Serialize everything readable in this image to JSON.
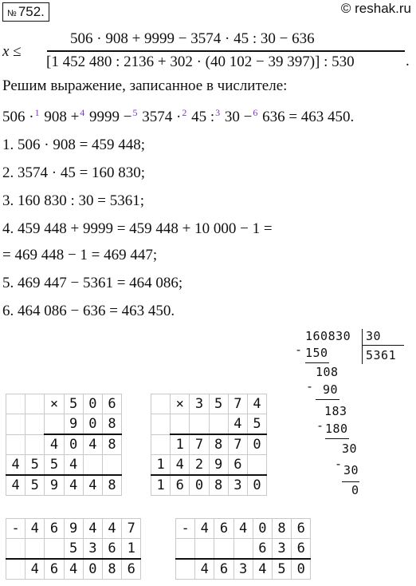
{
  "header": {
    "number_prefix": "№",
    "number": "752.",
    "site": "© reshak.ru"
  },
  "inequality": {
    "lhs": "x ≤",
    "numerator": "506 · 908 + 9999 − 3574 · 45 : 30 − 636",
    "denominator": "[1 452 480 : 2136 + 302 · (40 102 − 39 397)] : 530",
    "period": "."
  },
  "intro": "Решим выражение, записанное в числителе:",
  "expression": {
    "parts": [
      "506 ·",
      "908 +",
      "9999 −",
      "3574 ·",
      "45 :",
      "30 −",
      "636 = 463 450."
    ],
    "marks": [
      "1",
      "4",
      "5",
      "2",
      "3",
      "6"
    ]
  },
  "steps": [
    "1.  506 · 908 = 459 448;",
    "2.  3574 · 45 = 160 830;",
    "3.  160 830 : 30 = 5361;",
    "4.  459 448 + 9999 = 459 448 + 10 000 − 1 =",
    "= 469 448 − 1 = 469 447;",
    "5.  469 447 − 5361 = 464 086;",
    "6.  464 086 − 636 = 463 450."
  ],
  "mult1": {
    "rows": [
      [
        "",
        "",
        "×",
        "5",
        "0",
        "6"
      ],
      [
        "",
        "",
        "",
        "9",
        "0",
        "8"
      ],
      [
        "",
        "",
        "4",
        "0",
        "4",
        "8"
      ],
      [
        "4",
        "5",
        "5",
        "4",
        "",
        ""
      ],
      [
        "4",
        "5",
        "9",
        "4",
        "4",
        "8"
      ]
    ]
  },
  "mult2": {
    "rows": [
      [
        "",
        "×",
        "3",
        "5",
        "7",
        "4"
      ],
      [
        "",
        "",
        "",
        "",
        "4",
        "5"
      ],
      [
        "",
        "1",
        "7",
        "8",
        "7",
        "0"
      ],
      [
        "1",
        "4",
        "2",
        "9",
        "6",
        ""
      ],
      [
        "1",
        "6",
        "0",
        "8",
        "3",
        "0"
      ]
    ]
  },
  "sub1": {
    "rows": [
      [
        "-",
        "4",
        "6",
        "9",
        "4",
        "4",
        "7"
      ],
      [
        "",
        "",
        "",
        "5",
        "3",
        "6",
        "1"
      ],
      [
        "",
        "4",
        "6",
        "4",
        "0",
        "8",
        "6"
      ]
    ]
  },
  "sub2": {
    "rows": [
      [
        "-",
        "4",
        "6",
        "4",
        "0",
        "8",
        "6"
      ],
      [
        "",
        "",
        "",
        "",
        "6",
        "3",
        "6"
      ],
      [
        "",
        "4",
        "6",
        "3",
        "4",
        "5",
        "0"
      ]
    ]
  },
  "division": {
    "dividend": "160830",
    "divisor": "30",
    "quotient": "5361",
    "steps": [
      {
        "minus": "-",
        "value": "150"
      },
      {
        "value": "108"
      },
      {
        "minus": "-",
        "value": "90"
      },
      {
        "value": "183"
      },
      {
        "minus": "-",
        "value": "180"
      },
      {
        "value": "30"
      },
      {
        "minus": "-",
        "value": "30"
      },
      {
        "value": "0"
      }
    ]
  },
  "colors": {
    "marks": "#7a3cc8",
    "subtrahend": "#2a8a2a",
    "divisor": "#2b35a8",
    "quotient": "#b8232a"
  }
}
